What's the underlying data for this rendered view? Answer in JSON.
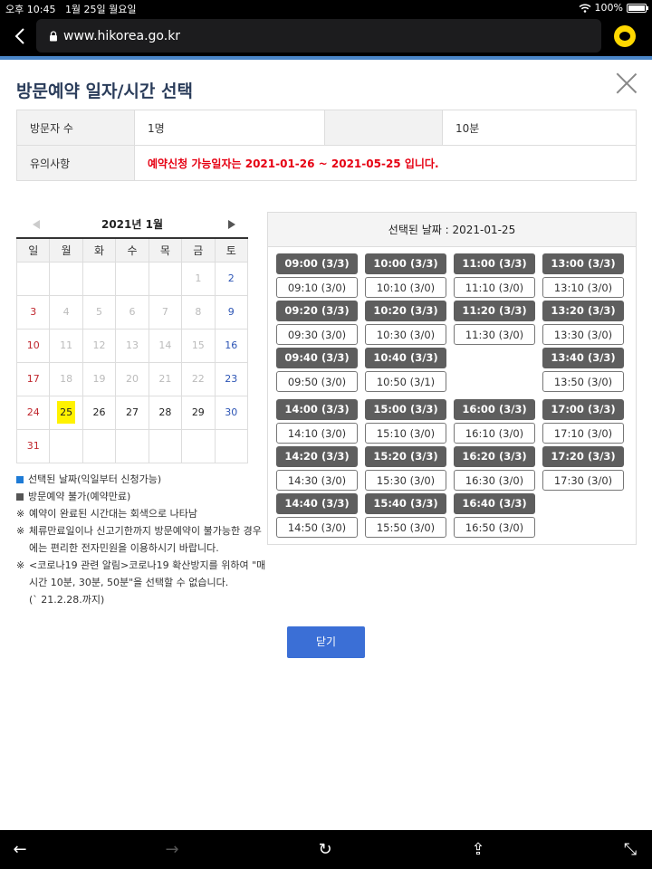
{
  "status": {
    "time": "오후 10:45",
    "date": "1월 25일 월요일",
    "battery": "100%"
  },
  "browser": {
    "url": "www.hikorea.go.kr"
  },
  "page": {
    "title": "방문예약 일자/시간 선택"
  },
  "info": {
    "visitors_label": "방문자 수",
    "visitors_value": "1명",
    "duration_value": "10분",
    "notice_label": "유의사항",
    "notice_value": "예약신청 가능일자는 2021-01-26 ~ 2021-05-25 입니다."
  },
  "calendar": {
    "title": "2021년 1월",
    "weekdays": [
      "일",
      "월",
      "화",
      "수",
      "목",
      "금",
      "토"
    ],
    "rows": [
      [
        "",
        "",
        "",
        "",
        "",
        "1",
        "2"
      ],
      [
        "3",
        "4",
        "5",
        "6",
        "7",
        "8",
        "9"
      ],
      [
        "10",
        "11",
        "12",
        "13",
        "14",
        "15",
        "16"
      ],
      [
        "17",
        "18",
        "19",
        "20",
        "21",
        "22",
        "23"
      ],
      [
        "24",
        "25",
        "26",
        "27",
        "28",
        "29",
        "30"
      ],
      [
        "31",
        "",
        "",
        "",
        "",
        "",
        ""
      ]
    ]
  },
  "legend": {
    "selected": "선택된 날짜(익일부터 신청가능)",
    "unavailable": "방문예약 불가(예약만료)",
    "note1": "예약이 완료된 시간대는 회색으로 나타남",
    "note2": "체류만료일이나 신고기한까지 방문예약이 불가능한 경우에는 편리한 전자민원을 이용하시기 바랍니다.",
    "note3a": "<코로나19 관련 알림>코로나19 확산방지를 위하여 \"매시간 10분, 30분, 50분\"을 선택할 수 없습니다.",
    "note3b": "(` 21.2.28.까지)",
    "ref_mark": "※"
  },
  "slots": {
    "header": "선택된 날짜 : 2021-01-25",
    "morning": [
      "09:00 (3/3)",
      "10:00 (3/3)",
      "11:00 (3/3)",
      "13:00 (3/3)",
      "09:10 (3/0)",
      "10:10 (3/0)",
      "11:10 (3/0)",
      "13:10 (3/0)",
      "09:20 (3/3)",
      "10:20 (3/3)",
      "11:20 (3/3)",
      "13:20 (3/3)",
      "09:30 (3/0)",
      "10:30 (3/0)",
      "11:30 (3/0)",
      "13:30 (3/0)",
      "09:40 (3/3)",
      "10:40 (3/3)",
      "",
      "13:40 (3/3)",
      "09:50 (3/0)",
      "10:50 (3/1)",
      "",
      "13:50 (3/0)"
    ],
    "afternoon": [
      "14:00 (3/3)",
      "15:00 (3/3)",
      "16:00 (3/3)",
      "17:00 (3/3)",
      "14:10 (3/0)",
      "15:10 (3/0)",
      "16:10 (3/0)",
      "17:10 (3/0)",
      "14:20 (3/3)",
      "15:20 (3/3)",
      "16:20 (3/3)",
      "17:20 (3/3)",
      "14:30 (3/0)",
      "15:30 (3/0)",
      "16:30 (3/0)",
      "17:30 (3/0)",
      "14:40 (3/3)",
      "15:40 (3/3)",
      "16:40 (3/3)",
      "",
      "14:50 (3/0)",
      "15:50 (3/0)",
      "16:50 (3/0)",
      ""
    ]
  },
  "buttons": {
    "close": "닫기"
  },
  "icons": {
    "back": "←",
    "forward": "→",
    "reload": "↻",
    "share": "⇪",
    "collapse": "⤡"
  }
}
